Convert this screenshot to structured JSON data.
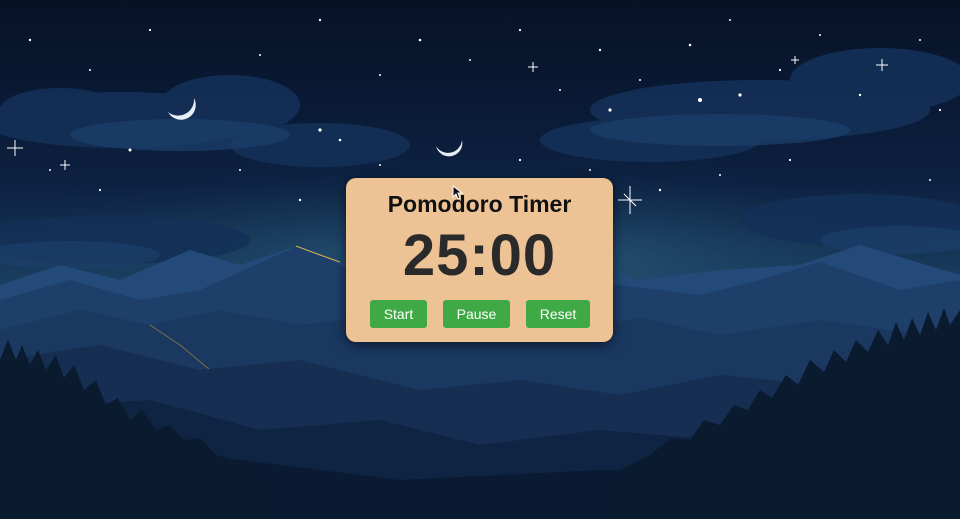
{
  "timer": {
    "title": "Pomodoro Timer",
    "display": "25:00",
    "buttons": {
      "start": "Start",
      "pause": "Pause",
      "reset": "Reset"
    }
  },
  "colors": {
    "card_background": "#edc395",
    "button_background": "#3faa45",
    "button_text": "#ffffff",
    "title_text": "#111111",
    "display_text": "#2a2a2a"
  },
  "background": {
    "description": "night-sky-mountains"
  }
}
